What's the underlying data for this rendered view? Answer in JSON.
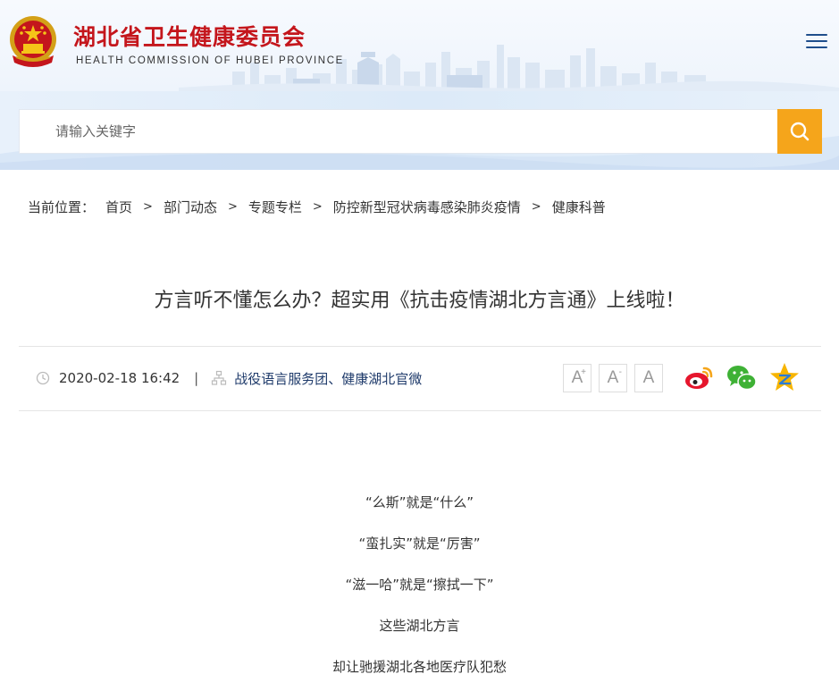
{
  "header": {
    "title": "湖北省卫生健康委员会",
    "subtitle": "HEALTH COMMISSION OF HUBEI PROVINCE",
    "brand_color": "#c4161c"
  },
  "search": {
    "placeholder": "请输入关键字",
    "button_color": "#f5a51b",
    "button_icon": "search-icon"
  },
  "breadcrumb": {
    "prefix": "当前位置：",
    "separator": ">",
    "items": [
      "首页",
      "部门动态",
      "专题专栏",
      "防控新型冠状病毒感染肺炎疫情",
      "健康科普"
    ]
  },
  "article": {
    "title": "方言听不懂怎么办？超实用《抗击疫情湖北方言通》上线啦！",
    "date": "2020-02-18 16:42",
    "source": "战役语言服务团、健康湖北官微",
    "font_controls": [
      "A",
      "A",
      "A"
    ],
    "font_control_marks": [
      "+",
      "-",
      ""
    ],
    "share": [
      "weibo-icon",
      "wechat-icon",
      "qzone-icon"
    ],
    "paragraphs": [
      "“么斯”就是“什么”",
      "“蛮扎实”就是“厉害”",
      "“滋一哈”就是“擦拭一下”",
      "这些湖北方言",
      "却让驰援湖北各地医疗队犯愁"
    ]
  }
}
